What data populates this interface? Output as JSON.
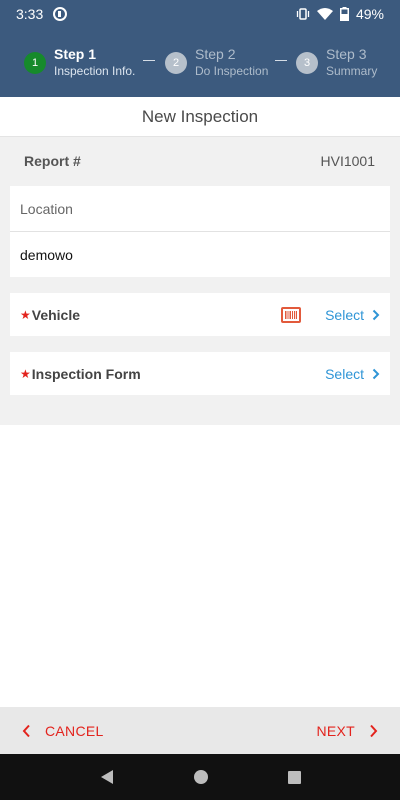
{
  "status_bar": {
    "time": "3:33",
    "battery": "49%",
    "icons": [
      "app-notification-icon",
      "vibrate-icon",
      "wifi-icon",
      "battery-icon"
    ]
  },
  "stepper": {
    "steps": [
      {
        "number": "1",
        "title": "Step 1",
        "subtitle": "Inspection Info.",
        "state": "active"
      },
      {
        "number": "2",
        "title": "Step 2",
        "subtitle": "Do Inspection",
        "state": "inactive"
      },
      {
        "number": "3",
        "title": "Step 3",
        "subtitle": "Summary",
        "state": "inactive"
      }
    ]
  },
  "page": {
    "title": "New Inspection"
  },
  "form": {
    "report_label": "Report #",
    "report_value": "HVI1001",
    "location_label": "Location",
    "location_value": "demowo",
    "vehicle_label": "Vehicle",
    "vehicle_action": "Select",
    "inspection_form_label": "Inspection Form",
    "inspection_form_action": "Select",
    "required_marker": "★"
  },
  "footer": {
    "cancel_label": "CANCEL",
    "next_label": "NEXT"
  },
  "colors": {
    "header_bg": "#3c5a7e",
    "active_step": "#168a2b",
    "accent_red": "#e3231d",
    "link_blue": "#2f95d6"
  }
}
